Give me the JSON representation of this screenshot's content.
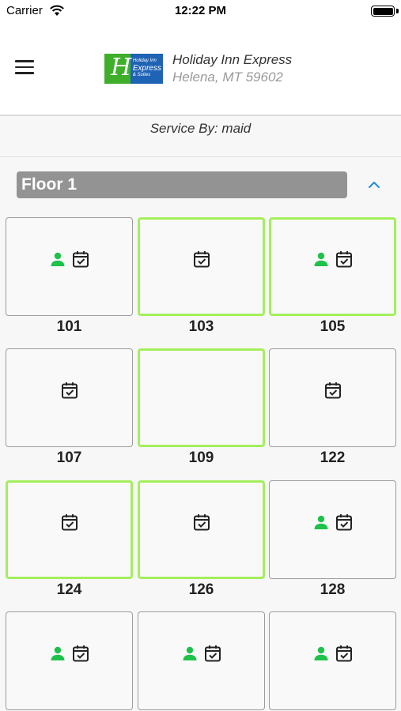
{
  "status_bar": {
    "carrier": "Carrier",
    "time": "12:22 PM"
  },
  "header": {
    "hotel_name": "Holiday Inn Express",
    "hotel_address": "Helena, MT 59602",
    "logo_text": "Holiday Inn Express & Suites"
  },
  "service": {
    "label": "Service By: maid"
  },
  "floor": {
    "title": "Floor 1",
    "expanded": true
  },
  "colors": {
    "highlight_border": "#a3ef5c",
    "person_icon": "#1ec24a",
    "floor_header_bg": "#939393",
    "collapse_icon": "#1a8ed8"
  },
  "rooms": [
    {
      "number": "101",
      "highlighted": false,
      "icons": [
        "person-icon",
        "calendar-check-icon"
      ]
    },
    {
      "number": "103",
      "highlighted": true,
      "icons": [
        "calendar-check-icon"
      ]
    },
    {
      "number": "105",
      "highlighted": true,
      "icons": [
        "person-icon",
        "calendar-check-icon"
      ]
    },
    {
      "number": "107",
      "highlighted": false,
      "icons": [
        "calendar-check-icon"
      ]
    },
    {
      "number": "109",
      "highlighted": true,
      "icons": []
    },
    {
      "number": "122",
      "highlighted": false,
      "icons": [
        "calendar-check-icon"
      ]
    },
    {
      "number": "124",
      "highlighted": true,
      "icons": [
        "calendar-check-icon"
      ]
    },
    {
      "number": "126",
      "highlighted": true,
      "icons": [
        "calendar-check-icon"
      ]
    },
    {
      "number": "128",
      "highlighted": false,
      "icons": [
        "person-icon",
        "calendar-check-icon"
      ]
    },
    {
      "number": "",
      "highlighted": false,
      "icons": [
        "person-icon",
        "calendar-check-icon"
      ]
    },
    {
      "number": "",
      "highlighted": false,
      "icons": [
        "person-icon",
        "calendar-check-icon"
      ]
    },
    {
      "number": "",
      "highlighted": false,
      "icons": [
        "person-icon",
        "calendar-check-icon"
      ]
    }
  ]
}
